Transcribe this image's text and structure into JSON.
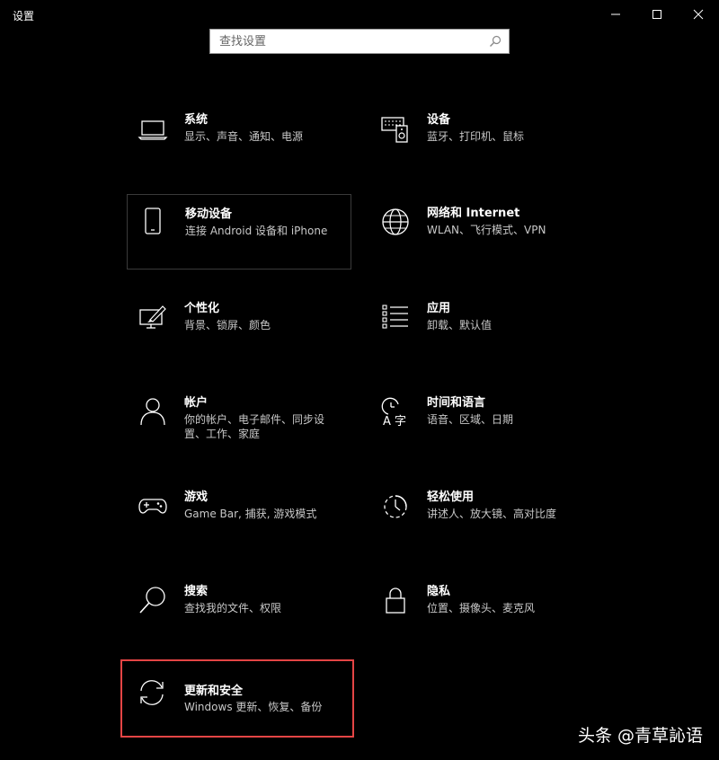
{
  "window": {
    "title": "设置"
  },
  "search": {
    "placeholder": "查找设置",
    "value": ""
  },
  "tiles": [
    {
      "label": "系统",
      "desc": "显示、声音、通知、电源",
      "icon": "laptop-icon"
    },
    {
      "label": "设备",
      "desc": "蓝牙、打印机、鼠标",
      "icon": "keyboard-speaker-icon"
    },
    {
      "label": "移动设备",
      "desc": "连接 Android 设备和 iPhone",
      "icon": "phone-icon"
    },
    {
      "label": "网络和 Internet",
      "desc": "WLAN、飞行模式、VPN",
      "icon": "globe-icon"
    },
    {
      "label": "个性化",
      "desc": "背景、锁屏、颜色",
      "icon": "paint-screen-icon"
    },
    {
      "label": "应用",
      "desc": "卸载、默认值",
      "icon": "apps-list-icon"
    },
    {
      "label": "帐户",
      "desc": "你的帐户、电子邮件、同步设置、工作、家庭",
      "icon": "person-icon"
    },
    {
      "label": "时间和语言",
      "desc": "语音、区域、日期",
      "icon": "time-language-icon"
    },
    {
      "label": "游戏",
      "desc": "Game Bar, 捕获, 游戏模式",
      "icon": "gamepad-icon"
    },
    {
      "label": "轻松使用",
      "desc": "讲述人、放大镜、高对比度",
      "icon": "ease-of-access-icon"
    },
    {
      "label": "搜索",
      "desc": "查找我的文件、权限",
      "icon": "magnifier-icon"
    },
    {
      "label": "隐私",
      "desc": "位置、摄像头、麦克风",
      "icon": "lock-icon"
    },
    {
      "label": "更新和安全",
      "desc": "Windows 更新、恢复、备份",
      "icon": "sync-icon"
    }
  ],
  "watermark": "头条 @青草訫语",
  "colors": {
    "background": "#000000",
    "highlight_border": "#e44545"
  }
}
